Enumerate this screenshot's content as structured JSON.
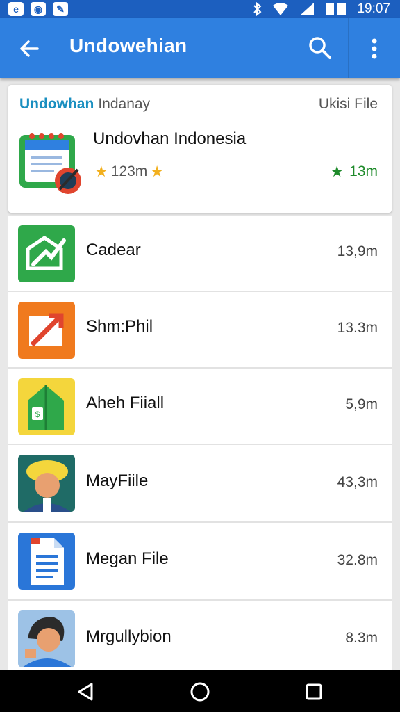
{
  "status_bar": {
    "time": "19:07",
    "left_icons": [
      "app-notification-icon-1",
      "app-notification-icon-2",
      "app-notification-icon-3"
    ],
    "right_icons": [
      "bluetooth-icon",
      "wifi-icon",
      "signal-icon",
      "battery-icon"
    ]
  },
  "app_bar": {
    "title": "Undowehian",
    "back_icon": "arrow-back-icon",
    "search_icon": "search-icon",
    "more_icon": "more-vert-icon",
    "color": "#2f80e0"
  },
  "featured": {
    "header_left": "Undowhan",
    "header_left_secondary": "Indanay",
    "header_right": "Ukisi File",
    "name": "Undovhan Indonesia",
    "rating_left": "123m",
    "rating_right": "13m"
  },
  "files": [
    {
      "name": "Cadear",
      "size": "13,9m",
      "icon": "checkbox-chart-icon",
      "color": "#2fa84a"
    },
    {
      "name": "Shm:Phil",
      "size": "13.3m",
      "icon": "arrow-box-icon",
      "color": "#f07a1e"
    },
    {
      "name": "Aheh Fiiall",
      "size": "5,9m",
      "icon": "green-folder-icon",
      "color": "#f4d63c"
    },
    {
      "name": "MayFiile",
      "size": "43,3m",
      "icon": "person-avatar-icon",
      "color": "#1f6b66"
    },
    {
      "name": "Megan File",
      "size": "32.8m",
      "icon": "document-icon",
      "color": "#2a76d8"
    },
    {
      "name": "Mrgullybion",
      "size": "8.3m",
      "icon": "person-avatar-icon-2",
      "color": "#6aa0d8"
    }
  ],
  "nav_bar": {
    "back": "nav-back-icon",
    "home": "nav-home-icon",
    "recents": "nav-recents-icon"
  }
}
